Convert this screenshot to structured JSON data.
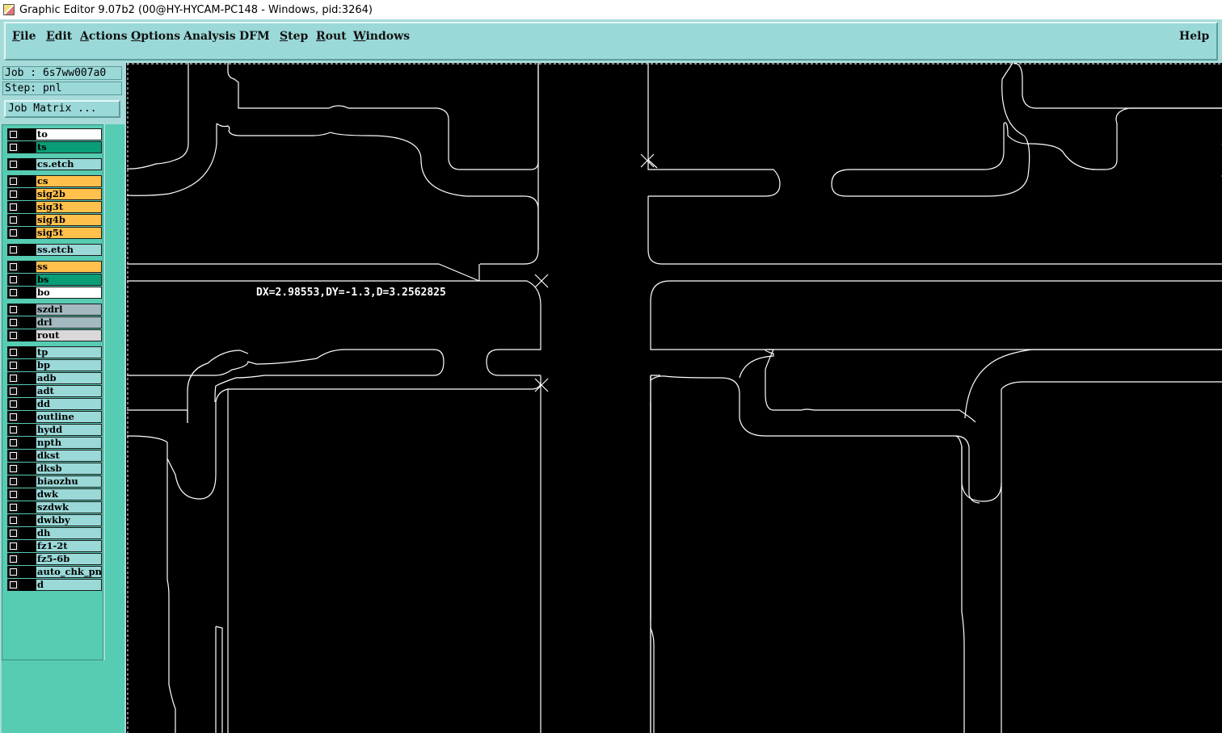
{
  "window": {
    "title": "Graphic Editor 9.07b2 (00@HY-HYCAM-PC148 - Windows, pid:3264)"
  },
  "menubar": {
    "items": [
      {
        "label": "File",
        "mnemonic": "F",
        "rest": "ile"
      },
      {
        "label": "Edit",
        "mnemonic": "E",
        "rest": "dit"
      },
      {
        "label": "Actions",
        "mnemonic": "A",
        "rest": "ctions"
      },
      {
        "label": "Options",
        "mnemonic": "O",
        "rest": "ptions"
      },
      {
        "label": "Analysis",
        "mnemonic": "",
        "rest": "Analysis"
      },
      {
        "label": "DFM",
        "mnemonic": "",
        "rest": "DFM"
      },
      {
        "label": "Step",
        "mnemonic": "S",
        "rest": "tep"
      },
      {
        "label": "Rout",
        "mnemonic": "R",
        "rest": "out"
      },
      {
        "label": "Windows",
        "mnemonic": "W",
        "rest": "indows"
      }
    ],
    "help": "Help"
  },
  "info": {
    "job": "Job : 6s7ww007a0",
    "step": "Step: pnl",
    "job_matrix": "Job Matrix ..."
  },
  "layers": [
    {
      "name": "to",
      "color": "#ffffff",
      "group": 0
    },
    {
      "name": "ts",
      "color": "#0a9e78",
      "group": 0
    },
    {
      "name": "cs.etch",
      "color": "#9bd8d8",
      "group": 1
    },
    {
      "name": "cs",
      "color": "#ffc04c",
      "group": 2
    },
    {
      "name": "sig2b",
      "color": "#ffc04c",
      "group": 2
    },
    {
      "name": "sig3t",
      "color": "#ffc04c",
      "group": 2
    },
    {
      "name": "sig4b",
      "color": "#ffc04c",
      "group": 2
    },
    {
      "name": "sig5t",
      "color": "#ffc04c",
      "group": 2
    },
    {
      "name": "ss.etch",
      "color": "#9bd8d8",
      "group": 3
    },
    {
      "name": "ss",
      "color": "#ffc04c",
      "group": 4
    },
    {
      "name": "bs",
      "color": "#0a9e78",
      "group": 4
    },
    {
      "name": "bo",
      "color": "#ffffff",
      "group": 4
    },
    {
      "name": "szdrl",
      "color": "#a3b8bf",
      "group": 5
    },
    {
      "name": "drl",
      "color": "#a3b8bf",
      "group": 5
    },
    {
      "name": "rout",
      "color": "#d9d9d9",
      "group": 5
    },
    {
      "name": "tp",
      "color": "#9bd8d8",
      "group": 6
    },
    {
      "name": "bp",
      "color": "#9bd8d8",
      "group": 6
    },
    {
      "name": "adb",
      "color": "#9bd8d8",
      "group": 6
    },
    {
      "name": "adt",
      "color": "#9bd8d8",
      "group": 6
    },
    {
      "name": "dd",
      "color": "#9bd8d8",
      "group": 6
    },
    {
      "name": "outline",
      "color": "#9bd8d8",
      "group": 6
    },
    {
      "name": "hydd",
      "color": "#9bd8d8",
      "group": 6
    },
    {
      "name": "npth",
      "color": "#9bd8d8",
      "group": 6
    },
    {
      "name": "dkst",
      "color": "#9bd8d8",
      "group": 6
    },
    {
      "name": "dksb",
      "color": "#9bd8d8",
      "group": 6
    },
    {
      "name": "biaozhu",
      "color": "#9bd8d8",
      "group": 6
    },
    {
      "name": "dwk",
      "color": "#9bd8d8",
      "group": 6
    },
    {
      "name": "szdwk",
      "color": "#9bd8d8",
      "group": 6
    },
    {
      "name": "dwkby",
      "color": "#9bd8d8",
      "group": 6
    },
    {
      "name": "dh",
      "color": "#9bd8d8",
      "group": 6
    },
    {
      "name": "fz1-2t",
      "color": "#9bd8d8",
      "group": 6
    },
    {
      "name": "fz5-6b",
      "color": "#9bd8d8",
      "group": 6
    },
    {
      "name": "auto_chk_pnl",
      "color": "#9bd8d8",
      "group": 6
    },
    {
      "name": "d",
      "color": "#9bd8d8",
      "group": 6
    }
  ],
  "canvas": {
    "measurement": "DX=2.98553,DY=-1.3,D=3.2562825"
  }
}
